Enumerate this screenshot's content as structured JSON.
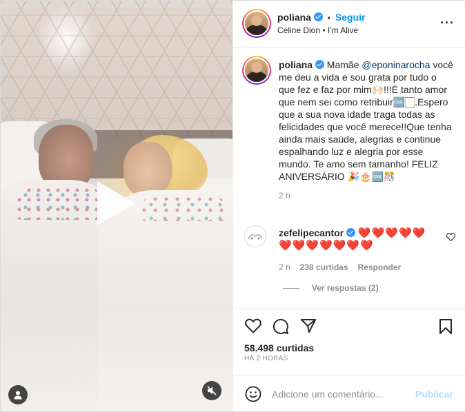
{
  "post": {
    "username": "poliana",
    "follow_label": "Seguir",
    "audio": "Céline Dion • I'm Alive",
    "caption_user": "poliana",
    "caption_prefix": "Mamãe ",
    "caption_mention": "@eponinarocha",
    "caption_body": "você me deu a vida e sou grata por tudo o que fez e faz por mim🙌🏻!!!É tanto amor que nem sei como retribuir🆒🏻.Espero que a sua nova idade traga todas as felicidades que você merece!!Que tenha ainda mais saúde, alegrias e continue espalhando luz e alegria por esse mundo. Te amo sem tamanho! FELIZ ANIVERSÁRIO 🎉🎂🆒🎊",
    "caption_time": "2 h"
  },
  "comment": {
    "username": "zefelipecantor",
    "hearts_line1": "❤️❤️❤️❤️❤️",
    "hearts_line2": "❤️❤️❤️❤️❤️❤️❤️",
    "time": "2 h",
    "likes": "238 curtidas",
    "reply_label": "Responder",
    "view_replies": "Ver respostas (2)"
  },
  "stats": {
    "likes": "58.498 curtidas",
    "posted": "HÁ 2 HORAS"
  },
  "add_comment": {
    "placeholder": "Adicione um comentário...",
    "publish_label": "Publicar"
  },
  "colors": {
    "accent": "#0095f6",
    "heart": "#ed4956",
    "muted": "#8e8e8e"
  }
}
